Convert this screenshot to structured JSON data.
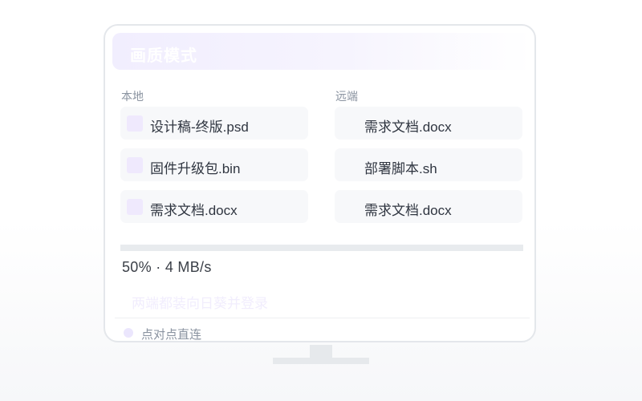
{
  "mode": {
    "title": "画质模式"
  },
  "local": {
    "label": "本地",
    "files": [
      {
        "name": "设计稿-终版.psd"
      },
      {
        "name": "固件升级包.bin"
      },
      {
        "name": "需求文档.docx"
      }
    ]
  },
  "remote": {
    "label": "远端",
    "files": [
      {
        "name": "需求文档.docx"
      },
      {
        "name": "部署脚本.sh"
      },
      {
        "name": "需求文档.docx"
      }
    ]
  },
  "transfer": {
    "progress_percent": 50,
    "status_text": "50% · 4 MB/s"
  },
  "hint": {
    "text": "两端都装向日葵并登录"
  },
  "connection": {
    "label": "点对点直连"
  },
  "colors": {
    "accent_light": "#efe9fd",
    "item_bg": "#f7f8fa",
    "border": "#e4e7eb"
  },
  "icons": {
    "file": "file-icon",
    "status": "status-dot-icon"
  }
}
